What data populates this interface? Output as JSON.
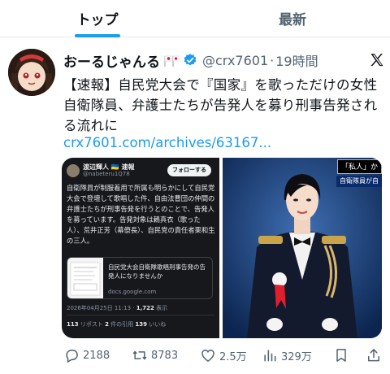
{
  "tabs": [
    {
      "label": "トップ",
      "active": true
    },
    {
      "label": "最新",
      "active": false
    }
  ],
  "tweet": {
    "display_name": "おーるじゃんる",
    "handle": "@crx7601",
    "separator": "·",
    "time": "19時間",
    "text": "【速報】自民党大会で『国家』を歌っただけの女性自衛隊員、弁護士たちが告発人を募り刑事告発される流れに",
    "link": "crx7601.com/archives/63167..."
  },
  "embedded_post": {
    "name": "渡辺輝人 🇺🇦 速報",
    "handle": "@nabeteru1Q78",
    "follow_label": "フォローする",
    "text": "自衛隊員が制服着用で所属も明らかにして自民党大会で登壇して歌唱した件、自由法曹団の仲間の弁護士たちが刑事告発を行うとのことで、告発人を募っています。告発対象は鶫真衣（歌った人）、荒井正芳（幕僚長）、自民党の責任者栗和生の三人。",
    "card_title": "自民党大会自衛隊歌唱刑事告発の告発人になりませんか",
    "card_domain": "docs.google.com",
    "meta_date": "2026年04月25日 11:13 · ",
    "meta_views": "1,722",
    "meta_views_label": " 表示",
    "stats_retweets": "113",
    "stats_retweets_label": " リポスト ",
    "stats_quotes": "2",
    "stats_quotes_label": " 件の引用 ",
    "stats_likes": "139",
    "stats_likes_label": " いいね"
  },
  "photo": {
    "caption_top": "「私人」か",
    "caption_bottom": "自衛隊員が自"
  },
  "actions": {
    "replies": "2188",
    "retweets": "8783",
    "likes": "2.5万",
    "views": "329万"
  },
  "colors": {
    "accent": "#1d9bf0",
    "muted": "#536471",
    "verified": "#1d9bf0"
  },
  "icons": [
    "japan-flag-icon",
    "verified-badge-icon",
    "x-logo-icon",
    "reply-icon",
    "retweet-icon",
    "like-icon",
    "views-icon",
    "bookmark-icon",
    "share-icon"
  ]
}
